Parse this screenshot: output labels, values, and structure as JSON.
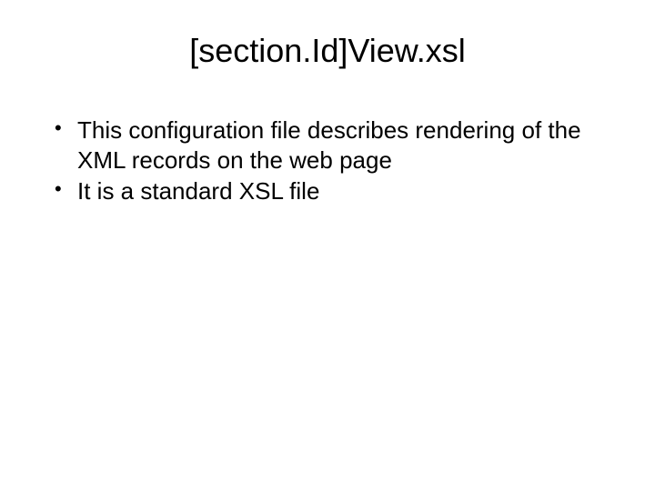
{
  "slide": {
    "title": "[section.Id]View.xsl",
    "bullets": [
      "This configuration file describes rendering of the XML records on the web page",
      "It is a standard XSL file"
    ]
  }
}
